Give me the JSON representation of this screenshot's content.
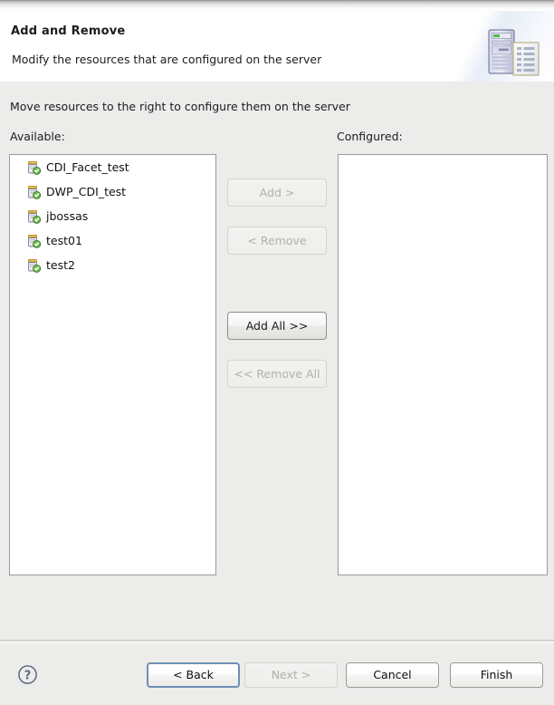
{
  "window": {
    "header": {
      "title": "Add and Remove",
      "description": "Modify the resources that are configured on the server",
      "icon": "server-and-document-icon"
    }
  },
  "content": {
    "instruction": "Move resources to the right to configure them on the server",
    "available": {
      "label": "Available:",
      "items": [
        {
          "name": "CDI_Facet_test",
          "icon": "module-jar-icon"
        },
        {
          "name": "DWP_CDI_test",
          "icon": "module-jar-icon"
        },
        {
          "name": "jbossas",
          "icon": "module-jar-icon"
        },
        {
          "name": "test01",
          "icon": "module-jar-icon"
        },
        {
          "name": "test2",
          "icon": "module-jar-icon"
        }
      ]
    },
    "configured": {
      "label": "Configured:",
      "items": []
    },
    "transfer_buttons": {
      "add": {
        "label": "Add >",
        "enabled": false
      },
      "remove": {
        "label": "< Remove",
        "enabled": false
      },
      "add_all": {
        "label": "Add All >>",
        "enabled": true
      },
      "remove_all": {
        "label": "<< Remove All",
        "enabled": false
      }
    }
  },
  "footer": {
    "help": {
      "icon": "help-question-icon"
    },
    "buttons": {
      "back": {
        "label": "< Back",
        "enabled": true,
        "is_default": true
      },
      "next": {
        "label": "Next >",
        "enabled": false,
        "is_default": false
      },
      "cancel": {
        "label": "Cancel",
        "enabled": true,
        "is_default": false
      },
      "finish": {
        "label": "Finish",
        "enabled": true,
        "is_default": false
      }
    }
  },
  "colors": {
    "dialog_background": "#ececeb",
    "header_background": "#ffffff",
    "list_background": "#ffffff",
    "border": "#9b9b96",
    "focus_border": "#6f8fb5",
    "disabled_text": "#b0b0ac",
    "text": "#1c1c1c",
    "badge_green": "#44a04a"
  }
}
